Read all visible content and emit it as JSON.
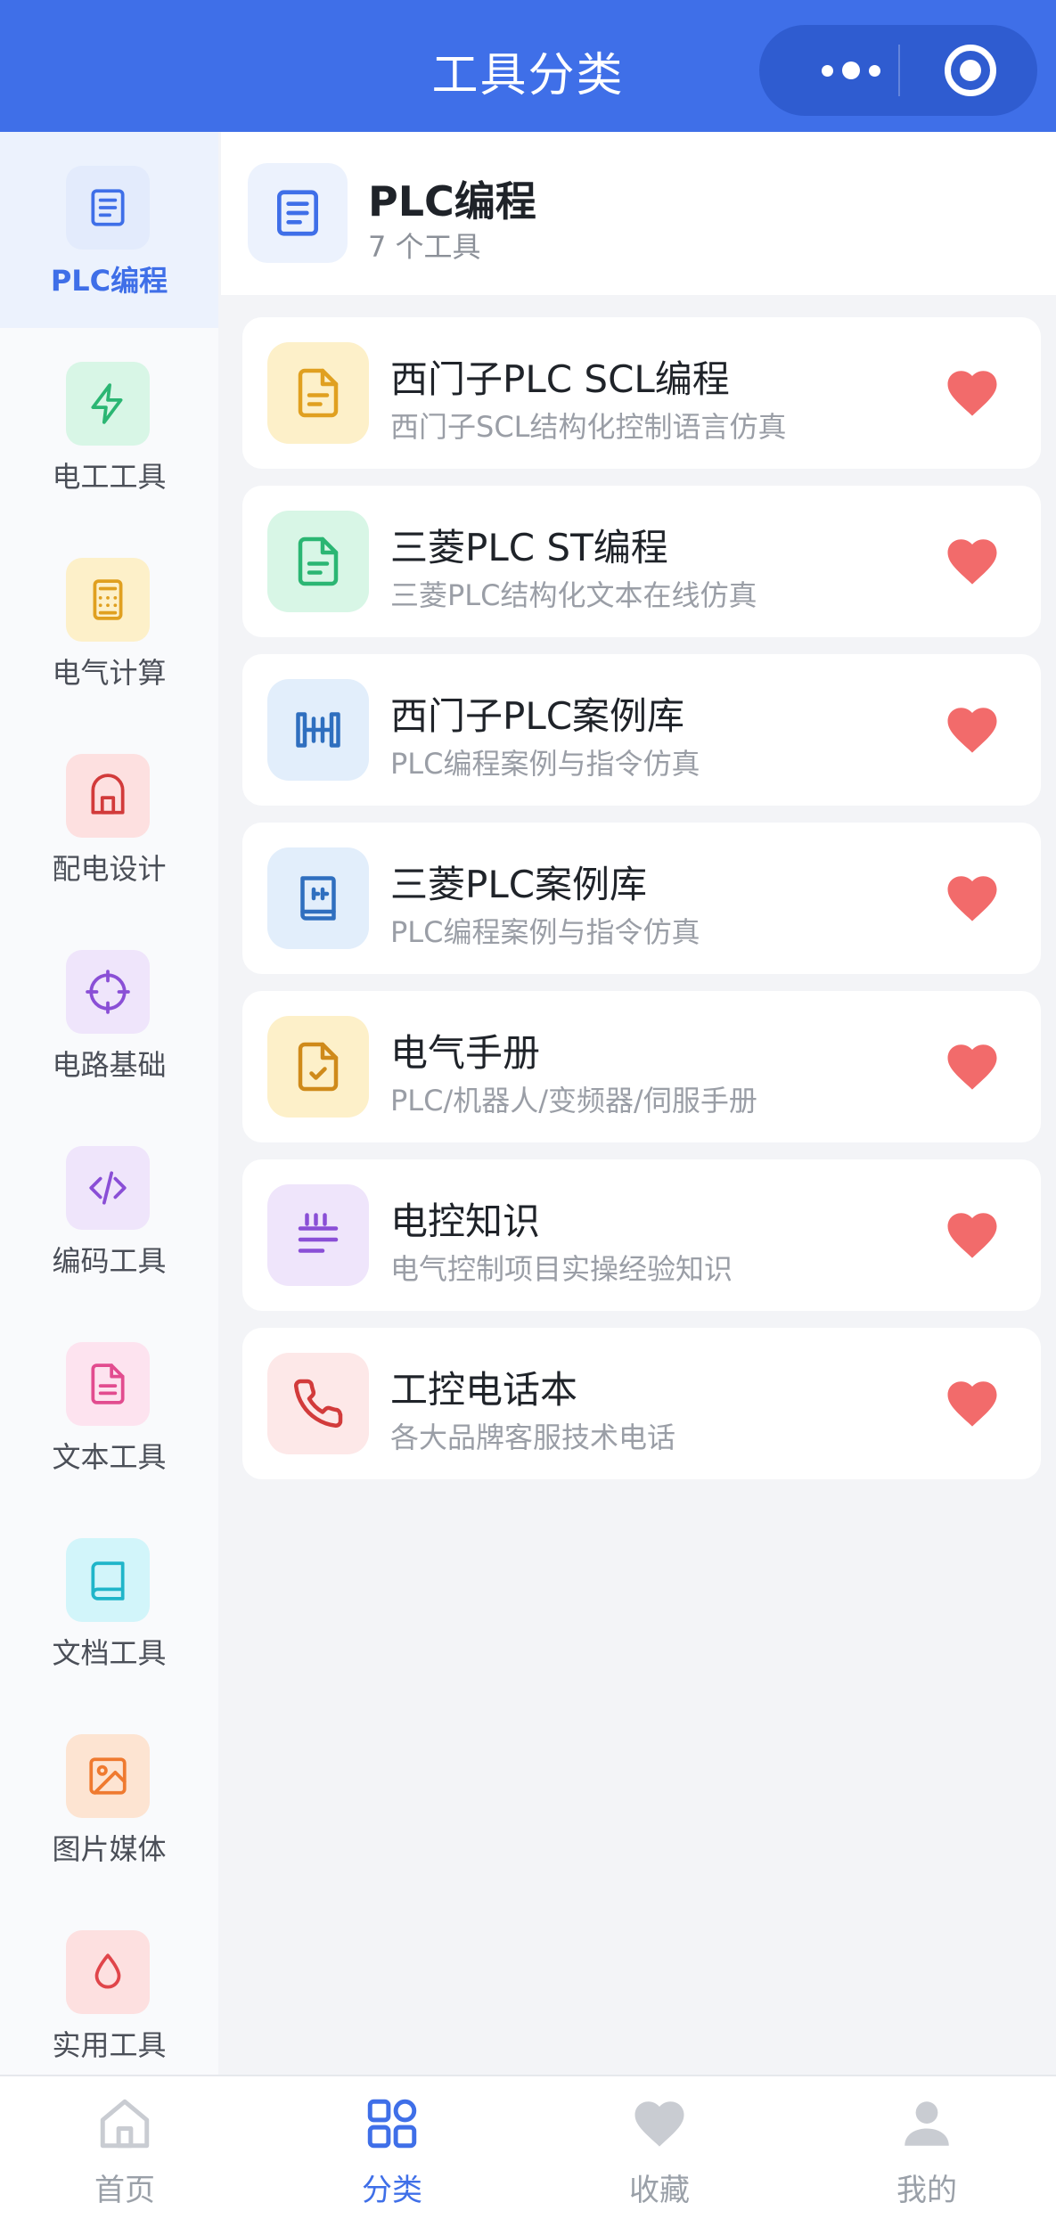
{
  "header": {
    "title": "工具分类"
  },
  "sidebar": {
    "items": [
      {
        "label": "PLC编程",
        "icon": "document-icon",
        "color": "#3f6fe8",
        "bg": "#e3ebfc",
        "active": true
      },
      {
        "label": "电工工具",
        "icon": "lightning-icon",
        "color": "#2bb673",
        "bg": "#d8f6e6",
        "active": false
      },
      {
        "label": "电气计算",
        "icon": "calculator-icon",
        "color": "#e0a020",
        "bg": "#fdf0c9",
        "active": false
      },
      {
        "label": "配电设计",
        "icon": "building-icon",
        "color": "#d23b3b",
        "bg": "#fde0e0",
        "active": false
      },
      {
        "label": "电路基础",
        "icon": "crosshair-icon",
        "color": "#8a4fd6",
        "bg": "#efe5fb",
        "active": false
      },
      {
        "label": "编码工具",
        "icon": "code-icon",
        "color": "#8a4fd6",
        "bg": "#efe5fb",
        "active": false
      },
      {
        "label": "文本工具",
        "icon": "file-text-icon",
        "color": "#e24c8f",
        "bg": "#fde3ef",
        "active": false
      },
      {
        "label": "文档工具",
        "icon": "book-icon",
        "color": "#1fb5c9",
        "bg": "#d2f5fa",
        "active": false
      },
      {
        "label": "图片媒体",
        "icon": "image-icon",
        "color": "#ef7a30",
        "bg": "#fde4d2",
        "active": false
      },
      {
        "label": "实用工具",
        "icon": "droplet-icon",
        "color": "#e0454a",
        "bg": "#fde0e0",
        "active": false
      }
    ]
  },
  "category": {
    "title": "PLC编程",
    "count": "7 个工具",
    "icon": "document-icon"
  },
  "tools": [
    {
      "title": "西门子PLC SCL编程",
      "desc": "西门子SCL结构化控制语言仿真",
      "icon": "file-icon",
      "color": "#e0a020",
      "bg": "#fdf0c9"
    },
    {
      "title": "三菱PLC ST编程",
      "desc": "三菱PLC结构化文本在线仿真",
      "icon": "file-icon",
      "color": "#2bb673",
      "bg": "#d8f6e6"
    },
    {
      "title": "西门子PLC案例库",
      "desc": "PLC编程案例与指令仿真",
      "icon": "ladder-icon",
      "color": "#2f6fbf",
      "bg": "#e2eefb"
    },
    {
      "title": "三菱PLC案例库",
      "desc": "PLC编程案例与指令仿真",
      "icon": "book-ladder-icon",
      "color": "#2f6fbf",
      "bg": "#e2eefb"
    },
    {
      "title": "电气手册",
      "desc": "PLC/机器人/变频器/伺服手册",
      "icon": "file-check-icon",
      "color": "#cf8a1a",
      "bg": "#fdf0c9"
    },
    {
      "title": "电控知识",
      "desc": "电气控制项目实操经验知识",
      "icon": "lines-icon",
      "color": "#8a4fd6",
      "bg": "#efe5fb"
    },
    {
      "title": "工控电话本",
      "desc": "各大品牌客服技术电话",
      "icon": "phone-icon",
      "color": "#d23b3b",
      "bg": "#fde8e8"
    }
  ],
  "favorite_color": "#f26b6b",
  "tabbar": {
    "tabs": [
      {
        "label": "首页",
        "icon": "home-icon",
        "active": false
      },
      {
        "label": "分类",
        "icon": "grid-icon",
        "active": true
      },
      {
        "label": "收藏",
        "icon": "heart-icon",
        "active": false
      },
      {
        "label": "我的",
        "icon": "user-icon",
        "active": false
      }
    ]
  }
}
